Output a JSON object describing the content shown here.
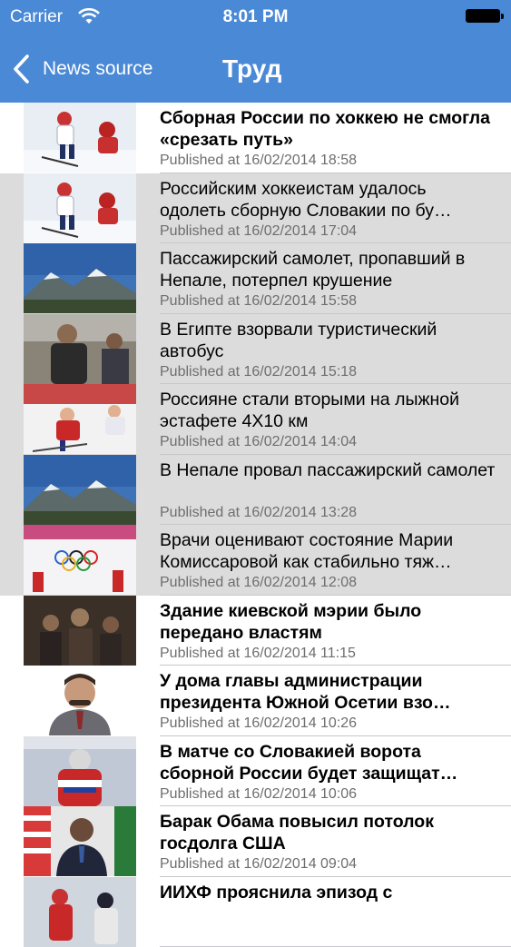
{
  "status_bar": {
    "carrier": "Carrier",
    "time": "8:01 PM"
  },
  "nav": {
    "back_label": "News source",
    "title": "Труд"
  },
  "colors": {
    "nav_bar": "#4a89d6",
    "read_row": "#dcdcdc",
    "date_text": "#6e6e6e"
  },
  "articles": [
    {
      "title": "Сборная России по хоккею не смогла «срезать путь»",
      "date": "Published at 16/02/2014 18:58",
      "read": false,
      "thumb": "hockey"
    },
    {
      "title": "Российским хоккеистам удалось одолеть сборную Словакии по бу…",
      "date": "Published at 16/02/2014 17:04",
      "read": true,
      "thumb": "hockey"
    },
    {
      "title": "Пассажирский самолет, пропавший в Непале, потерпел крушение",
      "date": "Published at 16/02/2014 15:58",
      "read": true,
      "thumb": "mountains"
    },
    {
      "title": "В Египте взорвали туристический автобус",
      "date": "Published at 16/02/2014 15:18",
      "read": true,
      "thumb": "people"
    },
    {
      "title": "Россияне стали вторыми на лыжной эстафете 4X10 км",
      "date": "Published at 16/02/2014 14:04",
      "read": true,
      "thumb": "skiing"
    },
    {
      "title": "В Непале провал пассажирский самолет",
      "date": "Published at 16/02/2014 13:28",
      "read": true,
      "thumb": "mountains"
    },
    {
      "title": "Врачи оценивают состояние Марии Комиссаровой как стабильно тяж…",
      "date": "Published at 16/02/2014 12:08",
      "read": true,
      "thumb": "olympics"
    },
    {
      "title": "Здание киевской мэрии было передано властям",
      "date": "Published at 16/02/2014 11:15",
      "read": false,
      "thumb": "crowd"
    },
    {
      "title": "У дома главы администрации президента Южной Осетии взо…",
      "date": "Published at 16/02/2014 10:26",
      "read": false,
      "thumb": "portrait"
    },
    {
      "title": "В матче со Словакией ворота сборной России будет защищат…",
      "date": "Published at 16/02/2014 10:06",
      "read": false,
      "thumb": "goalie"
    },
    {
      "title": "Барак Обама повысил потолок госдолга США",
      "date": "Published at 16/02/2014 09:04",
      "read": false,
      "thumb": "obama"
    },
    {
      "title": "ИИХФ прояснила эпизод с",
      "date": "",
      "read": false,
      "thumb": "hockey_red"
    }
  ]
}
